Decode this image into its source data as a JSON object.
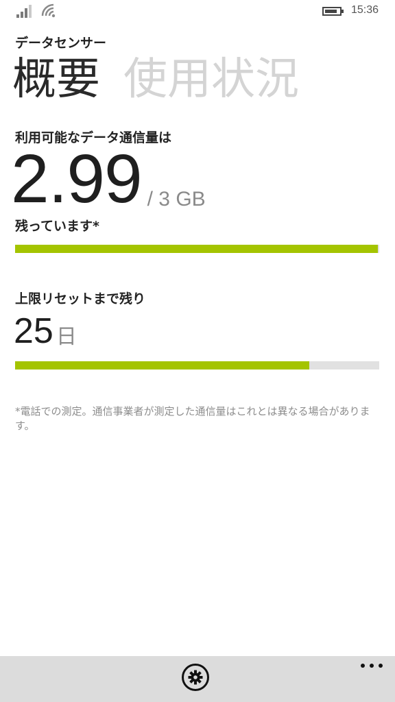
{
  "status_bar": {
    "time": "15:36",
    "signal_level": 0.75,
    "battery_level": 0.85,
    "icons": [
      "signal-icon",
      "wifi-icon",
      "battery-icon"
    ]
  },
  "app": {
    "title": "データセンサー"
  },
  "pivot": {
    "tabs": [
      {
        "label": "概要",
        "active": true
      },
      {
        "label": "使用状況",
        "active": false
      }
    ]
  },
  "data_remaining": {
    "label": "利用可能なデータ通信量は",
    "value": "2.99",
    "limit_text": "/ 3 GB",
    "suffix": "残っています*",
    "fraction": 0.9967
  },
  "reset": {
    "label": "上限リセットまで残り",
    "days": "25",
    "unit": "日",
    "fraction": 0.807
  },
  "footnote": "*電話での測定。通信事業者が測定した通信量はこれとは異なる場合があります。",
  "app_bar": {
    "icons": [
      "gear-icon",
      "more-icon"
    ]
  },
  "colors": {
    "accent": "#a4c400",
    "track": "#e1e1e1",
    "app_bar": "#dcdcdc",
    "inactive_tab": "#d4d4d4"
  }
}
